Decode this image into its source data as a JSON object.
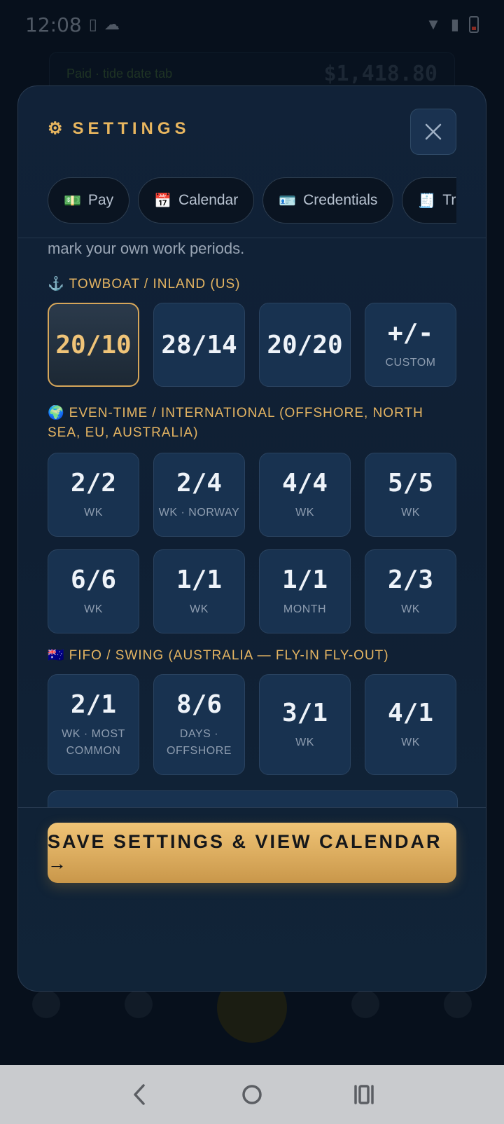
{
  "status_bar": {
    "time": "12:08"
  },
  "background": {
    "banner_text": "Paid · tide date tab",
    "banner_amount": "$1,418.80"
  },
  "modal": {
    "title": "SETTINGS",
    "tabs": [
      {
        "icon": "💵",
        "label": "Pay"
      },
      {
        "icon": "📅",
        "label": "Calendar"
      },
      {
        "icon": "🪪",
        "label": "Credentials"
      },
      {
        "icon": "🧾",
        "label": "Travel"
      }
    ],
    "intro_cut_text": "mark your own work periods.",
    "sections": [
      {
        "icon": "⚓",
        "label": "TOWBOAT / INLAND (US)",
        "options": [
          {
            "value": "20/10",
            "sub": "",
            "selected": true
          },
          {
            "value": "28/14",
            "sub": ""
          },
          {
            "value": "20/20",
            "sub": ""
          },
          {
            "value": "+/-",
            "sub": "CUSTOM"
          }
        ]
      },
      {
        "icon": "🌍",
        "label": "EVEN-TIME / INTERNATIONAL (OFFSHORE, NORTH SEA, EU, AUSTRALIA)",
        "options": [
          {
            "value": "2/2",
            "sub": "WK"
          },
          {
            "value": "2/4",
            "sub": "WK · NORWAY"
          },
          {
            "value": "4/4",
            "sub": "WK"
          },
          {
            "value": "5/5",
            "sub": "WK"
          },
          {
            "value": "6/6",
            "sub": "WK"
          },
          {
            "value": "1/1",
            "sub": "WK"
          },
          {
            "value": "1/1",
            "sub": "MONTH"
          },
          {
            "value": "2/3",
            "sub": "WK"
          }
        ]
      },
      {
        "icon": "🇦🇺",
        "label": "FIFO / SWING (AUSTRALIA — FLY-IN FLY-OUT)",
        "options": [
          {
            "value": "2/1",
            "sub": "WK · MOST COMMON"
          },
          {
            "value": "8/6",
            "sub": "DAYS · OFFSHORE"
          },
          {
            "value": "3/1",
            "sub": "WK"
          },
          {
            "value": "4/1",
            "sub": "WK"
          }
        ]
      }
    ],
    "save_button": "SAVE SETTINGS & VIEW CALENDAR →"
  },
  "colors": {
    "accent": "#e8b65f",
    "modal_bg": "#112238",
    "card_bg": "#183250",
    "selected_border": "#d6a65a"
  }
}
